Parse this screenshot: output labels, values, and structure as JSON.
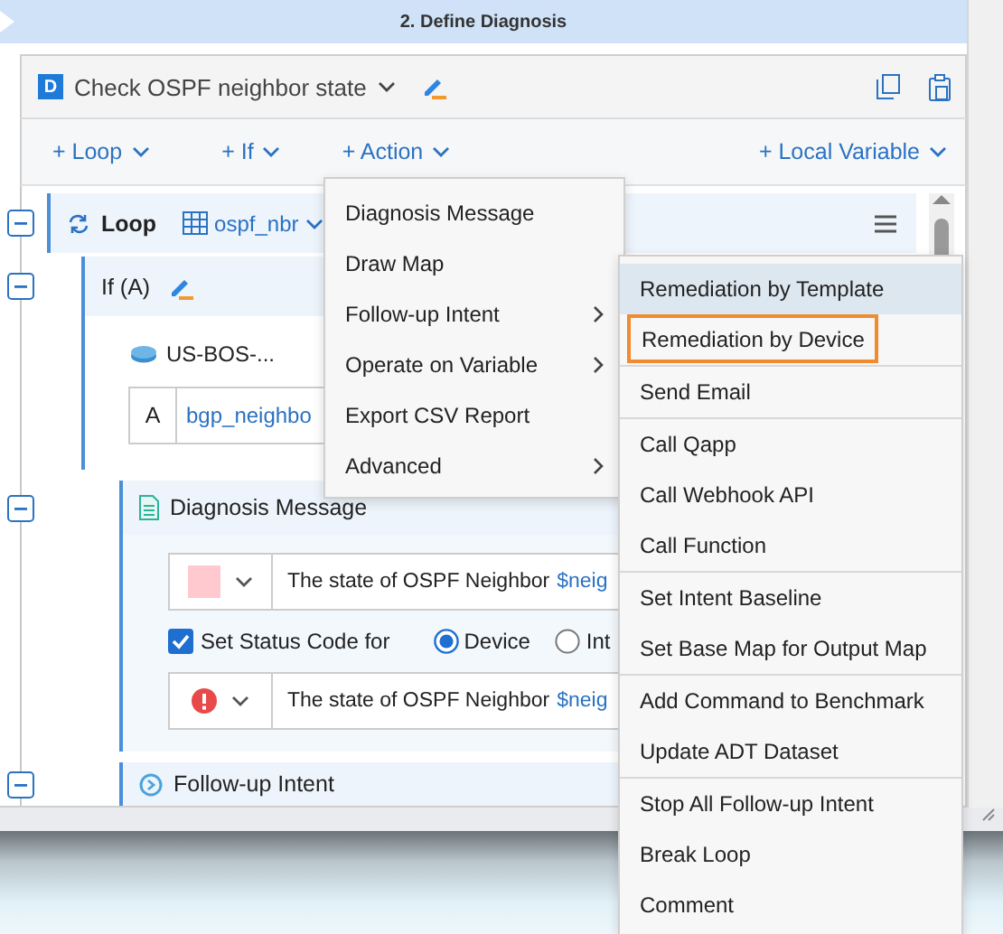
{
  "header": {
    "title": "2. Define Diagnosis"
  },
  "card": {
    "badge": "D",
    "title": "Check OSPF neighbor state"
  },
  "toolbar": [
    {
      "label": "+ Loop"
    },
    {
      "label": "+ If"
    },
    {
      "label": "+ Action"
    },
    {
      "label": "+ Local Variable"
    }
  ],
  "tree": {
    "loop": {
      "label": "Loop",
      "table": "ospf_nbr"
    },
    "if_block": {
      "label": "If (A)",
      "device": "US-BOS-...",
      "condition": {
        "key": "A",
        "value": "bgp_neighbo"
      }
    },
    "diagnosis": {
      "title": "Diagnosis Message",
      "message": {
        "text": "The state of OSPF Neighbor",
        "variable": "$neig"
      },
      "status": {
        "checked": true,
        "label": "Set Status Code for",
        "options": [
          {
            "label": "Device",
            "selected": true
          },
          {
            "label": "Int",
            "selected": false
          }
        ]
      },
      "status_message": {
        "text": "The state of OSPF Neighbor",
        "variable": "$neig"
      }
    },
    "followup": {
      "title": "Follow-up Intent"
    }
  },
  "action_menu": [
    {
      "label": "Diagnosis Message",
      "has_submenu": false
    },
    {
      "label": "Draw Map",
      "has_submenu": false
    },
    {
      "label": "Follow-up Intent",
      "has_submenu": true
    },
    {
      "label": "Operate on Variable",
      "has_submenu": true
    },
    {
      "label": "Export CSV Report",
      "has_submenu": false
    },
    {
      "label": "Advanced",
      "has_submenu": true
    }
  ],
  "submenu": [
    [
      {
        "label": "Remediation by Template",
        "hovered": true,
        "highlighted": false
      },
      {
        "label": "Remediation by Device",
        "hovered": false,
        "highlighted": true
      }
    ],
    [
      {
        "label": "Send Email",
        "hovered": false,
        "highlighted": false
      }
    ],
    [
      {
        "label": "Call Qapp",
        "hovered": false,
        "highlighted": false
      },
      {
        "label": "Call Webhook API",
        "hovered": false,
        "highlighted": false
      },
      {
        "label": "Call Function",
        "hovered": false,
        "highlighted": false
      }
    ],
    [
      {
        "label": "Set Intent Baseline",
        "hovered": false,
        "highlighted": false
      },
      {
        "label": "Set Base Map for Output Map",
        "hovered": false,
        "highlighted": false
      }
    ],
    [
      {
        "label": "Add Command to Benchmark",
        "hovered": false,
        "highlighted": false
      },
      {
        "label": "Update ADT Dataset",
        "hovered": false,
        "highlighted": false
      }
    ],
    [
      {
        "label": "Stop All Follow-up Intent",
        "hovered": false,
        "highlighted": false
      },
      {
        "label": "Break Loop",
        "hovered": false,
        "highlighted": false
      },
      {
        "label": "Comment",
        "hovered": false,
        "highlighted": false
      }
    ]
  ]
}
